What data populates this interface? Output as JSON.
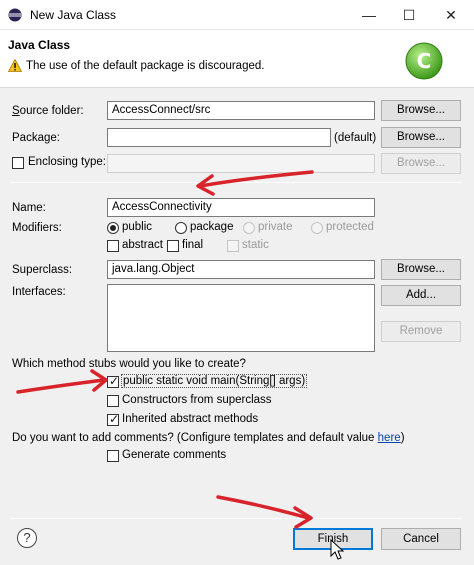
{
  "window": {
    "title": "New Java Class",
    "minimize": "—",
    "maximize": "☐",
    "close": "✕"
  },
  "header": {
    "title": "Java Class",
    "warning": "The use of the default package is discouraged.",
    "logo_letter": "C"
  },
  "form": {
    "source_folder": {
      "label": "Source folder:",
      "value": "AccessConnect/src",
      "browse": "Browse..."
    },
    "package": {
      "label": "Package:",
      "value": "",
      "suffix": "(default)",
      "browse": "Browse..."
    },
    "enclosing_type": {
      "label": "Enclosing type:",
      "value": "",
      "browse": "Browse..."
    },
    "name": {
      "label": "Name:",
      "value": "AccessConnectivity"
    },
    "modifiers": {
      "label": "Modifiers:",
      "public": "public",
      "package": "package",
      "private": "private",
      "protected": "protected",
      "abstract": "abstract",
      "final": "final",
      "static": "static"
    },
    "superclass": {
      "label": "Superclass:",
      "value": "java.lang.Object",
      "browse": "Browse..."
    },
    "interfaces": {
      "label": "Interfaces:",
      "add": "Add...",
      "remove": "Remove"
    },
    "stubs": {
      "question": "Which method stubs would you like to create?",
      "main": "public static void main(String[] args)",
      "constructors": "Constructors from superclass",
      "inherited": "Inherited abstract methods"
    },
    "comments": {
      "question": "Do you want to add comments? (Configure templates and default value ",
      "link": "here",
      "close_paren": ")",
      "generate": "Generate comments"
    }
  },
  "footer": {
    "help": "?",
    "finish": "Finish",
    "cancel": "Cancel"
  },
  "colors": {
    "arrow": "#d8232a",
    "logo": "#5cb82e"
  }
}
